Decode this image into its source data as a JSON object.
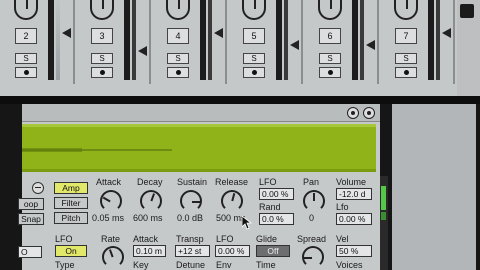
{
  "mixer": {
    "tracks": [
      {
        "number": "2",
        "solo": "S"
      },
      {
        "number": "3",
        "solo": "S"
      },
      {
        "number": "4",
        "solo": "S"
      },
      {
        "number": "5",
        "solo": "S"
      },
      {
        "number": "6",
        "solo": "S"
      },
      {
        "number": "7",
        "solo": "S"
      }
    ]
  },
  "device": {
    "col1": {
      "loop": "oop",
      "snap": "Snap",
      "o_val": "O"
    },
    "mode_buttons": {
      "amp": "Amp",
      "filter": "Filter",
      "pitch": "Pitch"
    },
    "envelope": {
      "attack_label": "Attack",
      "attack_value": "0.05 ms",
      "decay_label": "Decay",
      "decay_value": "600 ms",
      "sustain_label": "Sustain",
      "sustain_value": "0.0 dB",
      "release_label": "Release",
      "release_value": "500 ms"
    },
    "lfo_section": {
      "lfo_label": "LFO",
      "lfo_value": "0.00 %",
      "rand_label": "Rand",
      "rand_value": "0.0 %",
      "pan_label": "Pan",
      "pan_value": "0"
    },
    "volume_section": {
      "volume_label": "Volume",
      "volume_value": "-12.0 d",
      "lfo_label": "Lfo",
      "lfo_value": "0.00 %"
    },
    "bottom": {
      "lfo_label": "LFO",
      "lfo_on": "On",
      "type_label": "Type",
      "rate_label": "Rate",
      "attack_label": "Attack",
      "attack_value": "0.10 m",
      "key_label": "Key",
      "transp_label": "Transp",
      "transp_value": "+12 st",
      "detune_label": "Detune",
      "lfo2_label": "LFO",
      "lfo2_value": "0.00 %",
      "env_label": "Env",
      "glide_label": "Glide",
      "glide_value": "Off",
      "time_label": "Time",
      "spread_label": "Spread",
      "vel_label": "Vel",
      "vel_value": "50 %",
      "voices_label": "Voices"
    }
  },
  "colors": {
    "waveform": "#8fb318",
    "active_button": "#e2e86a",
    "meter_green": "#55c84a"
  }
}
